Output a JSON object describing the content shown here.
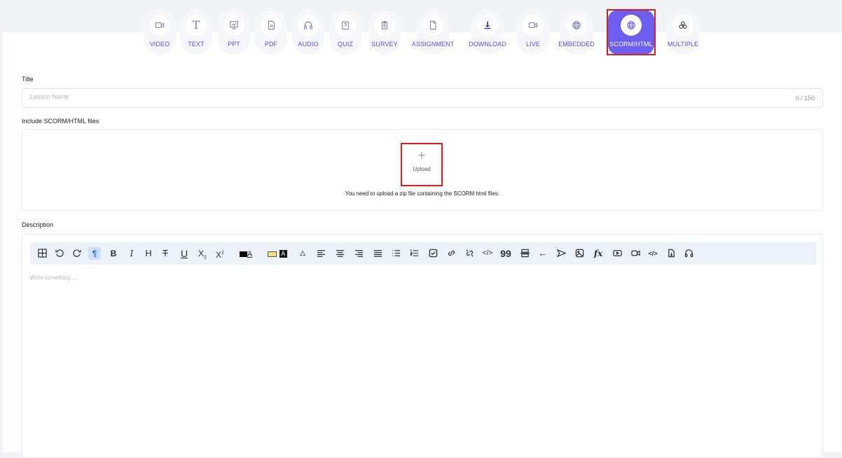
{
  "lesson_types": [
    {
      "label": "VIDEO",
      "icon": "video-icon"
    },
    {
      "label": "TEXT",
      "icon": "text-icon"
    },
    {
      "label": "PPT",
      "icon": "presentation-icon"
    },
    {
      "label": "PDF",
      "icon": "document-icon"
    },
    {
      "label": "AUDIO",
      "icon": "headphones-icon"
    },
    {
      "label": "QUIZ",
      "icon": "quiz-icon"
    },
    {
      "label": "SURVEY",
      "icon": "survey-icon"
    },
    {
      "label": "ASSIGNMENT",
      "icon": "file-icon"
    },
    {
      "label": "DOWNLOAD",
      "icon": "download-icon"
    },
    {
      "label": "LIVE",
      "icon": "live-video-icon"
    },
    {
      "label": "EMBEDDED",
      "icon": "globe-icon"
    },
    {
      "label": "SCORM/HTML",
      "icon": "globe-icon",
      "active": true
    },
    {
      "label": "MULTIPLE",
      "icon": "multiple-icon"
    }
  ],
  "title_field": {
    "label": "Title",
    "placeholder": "Lesson Name",
    "value": "",
    "counter": "0 / 150"
  },
  "files_field": {
    "label": "Include SCORM/HTML files",
    "upload_label": "Upload",
    "hint": "You need to upload a zip file containing the SCORM html files."
  },
  "description_field": {
    "label": "Description",
    "placeholder": "Write something ..."
  },
  "toolbar_icons": [
    "table-icon",
    "undo-icon",
    "redo-icon",
    "paragraph-icon",
    "bold-icon",
    "italic-icon",
    "heading-icon",
    "strikethrough-icon",
    "underline-icon",
    "subscript-icon",
    "superscript-icon",
    "text-color-icon",
    "highlight-color-icon",
    "clear-format-icon",
    "align-left-icon",
    "align-center-icon",
    "align-right-icon",
    "align-justify-icon",
    "bullet-list-icon",
    "ordered-list-icon",
    "task-list-icon",
    "link-icon",
    "unlink-icon",
    "code-icon",
    "blockquote-icon",
    "horizontal-rule-icon",
    "hard-break-icon",
    "send-icon",
    "image-icon",
    "formula-icon",
    "youtube-icon",
    "video-icon",
    "embed-code-icon",
    "file-icon",
    "audio-icon"
  ],
  "colors": {
    "accent": "#6c5ff0",
    "label": "#5c4de8",
    "highlight": "#e21a1a",
    "toolbar_bg": "#edf1f9"
  }
}
